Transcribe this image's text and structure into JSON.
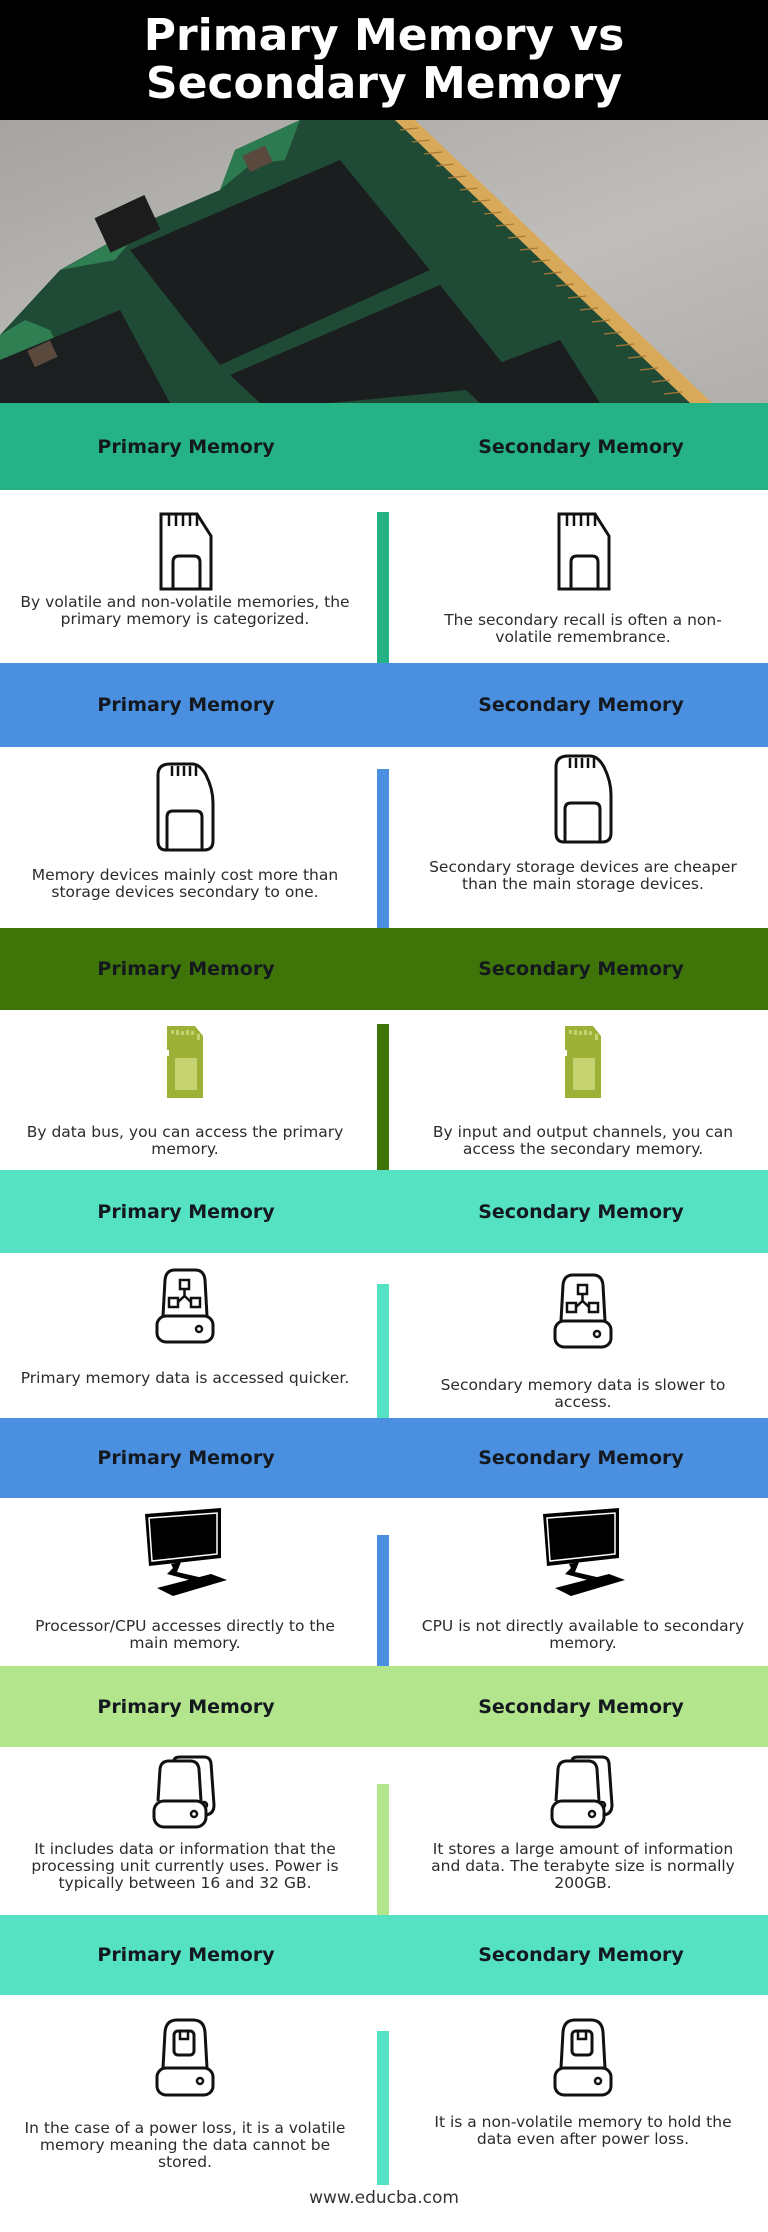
{
  "title": {
    "line1": "Primary Memory vs",
    "line2": "Secondary Memory"
  },
  "hero_image": {
    "subject": "RAM memory module close-up"
  },
  "colors": {
    "title_bg": "#000000",
    "band1": "#25b385",
    "band2": "#4a8fe0",
    "band3": "#3f7508",
    "band4": "#55e2c2",
    "band5": "#4a8fe0",
    "band6": "#b3e58d",
    "band7": "#55e2c2",
    "sd_card_fill": "#9db137",
    "sd_card_inner": "#c5d26f"
  },
  "sections": [
    {
      "primary_heading": "Primary Memory",
      "secondary_heading": "Secondary Memory",
      "icon": "sd-card-outline-icon",
      "primary_text": "By volatile and non-volatile memories, the primary memory is categorized.",
      "secondary_text": "The secondary recall is often a non-volatile remembrance."
    },
    {
      "primary_heading": "Primary Memory",
      "secondary_heading": "Secondary Memory",
      "icon": "sim-card-rounded-icon",
      "primary_text": "Memory devices mainly cost more than storage devices secondary to one.",
      "secondary_text": "Secondary storage devices are cheaper than the main storage devices."
    },
    {
      "primary_heading": "Primary Memory",
      "secondary_heading": "Secondary Memory",
      "icon": "sd-card-filled-icon",
      "primary_text": "By data bus, you can access the primary memory.",
      "secondary_text": "By input and output channels, you can access the secondary memory."
    },
    {
      "primary_heading": "Primary Memory",
      "secondary_heading": "Secondary Memory",
      "icon": "network-drive-icon",
      "primary_text": "Primary memory data is accessed quicker.",
      "secondary_text": "Secondary memory data is slower to access."
    },
    {
      "primary_heading": "Primary Memory",
      "secondary_heading": "Secondary Memory",
      "icon": "computer-monitor-icon",
      "primary_text": "Processor/CPU accesses directly to the main memory.",
      "secondary_text": "CPU is not directly available to secondary memory."
    },
    {
      "primary_heading": "Primary Memory",
      "secondary_heading": "Secondary Memory",
      "icon": "multiple-drives-icon",
      "primary_text": "It includes data or information that the processing unit currently uses. Power is typically between 16 and 32 GB.",
      "secondary_text": "It stores a large amount of information and data. The terabyte size is normally 200GB."
    },
    {
      "primary_heading": "Primary Memory",
      "secondary_heading": "Secondary Memory",
      "icon": "save-drive-icon",
      "primary_text": "In the case of a power loss, it is a volatile memory meaning the data cannot be stored.",
      "secondary_text": "It is a non-volatile memory to hold the data even after power loss."
    }
  ],
  "footer": {
    "site": "www.educba.com"
  }
}
